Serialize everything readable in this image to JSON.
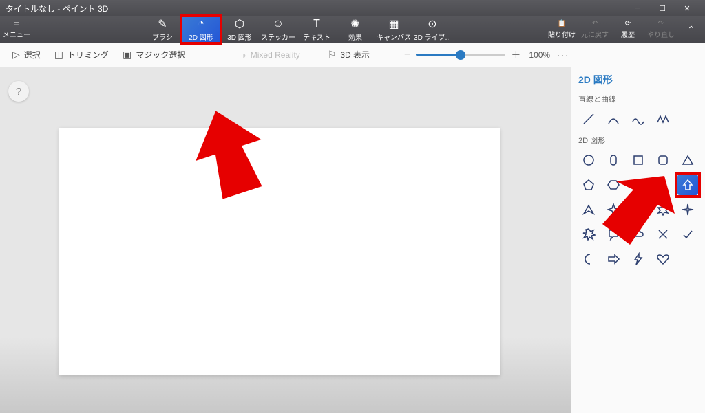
{
  "window": {
    "title": "タイトルなし - ペイント 3D"
  },
  "menu": {
    "label": "メニュー"
  },
  "tools": [
    {
      "id": "brush",
      "label": "ブラシ"
    },
    {
      "id": "shape2d",
      "label": "2D 図形",
      "active": true,
      "highlighted": true
    },
    {
      "id": "shape3d",
      "label": "3D 図形"
    },
    {
      "id": "sticker",
      "label": "ステッカー"
    },
    {
      "id": "text",
      "label": "テキスト"
    },
    {
      "id": "effect",
      "label": "効果"
    },
    {
      "id": "canvas",
      "label": "キャンバス"
    },
    {
      "id": "lib3d",
      "label": "3D ライブ..."
    }
  ],
  "right": {
    "paste": "貼り付け",
    "undo": "元に戻す",
    "history": "履歴",
    "redo": "やり直し"
  },
  "secondary": {
    "select": "選択",
    "trim": "トリミング",
    "magic": "マジック選択",
    "mixed": "Mixed Reality",
    "view3d": "3D 表示",
    "minus": "−",
    "plus": "＋",
    "zoom": "100%",
    "more": "···"
  },
  "panel": {
    "title": "2D 図形",
    "section1": "直線と曲線",
    "section2": "2D 図形"
  }
}
